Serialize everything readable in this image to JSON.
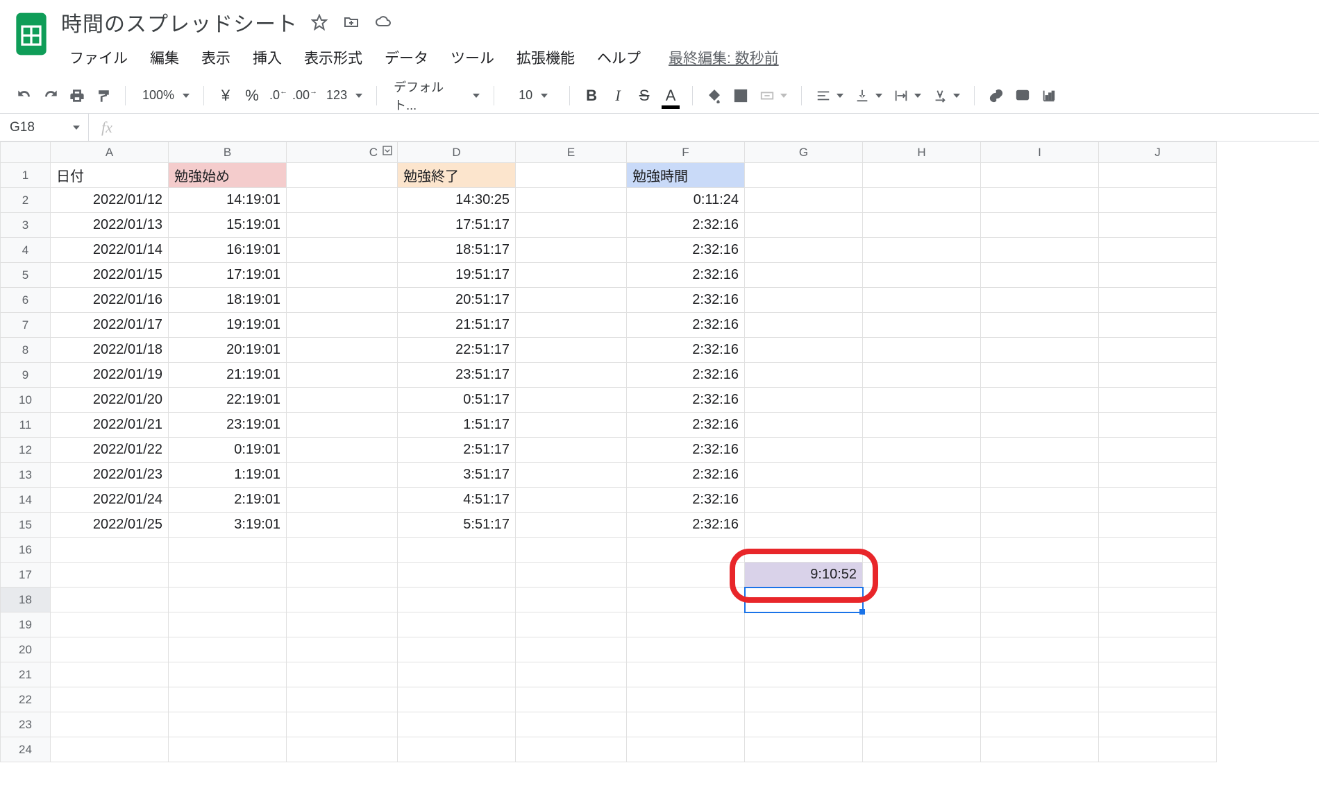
{
  "doc": {
    "title": "時間のスプレッドシート"
  },
  "menubar": {
    "items": [
      "ファイル",
      "編集",
      "表示",
      "挿入",
      "表示形式",
      "データ",
      "ツール",
      "拡張機能",
      "ヘルプ"
    ],
    "last_edit": "最終編集: 数秒前"
  },
  "toolbar": {
    "zoom": "100%",
    "currency": "¥",
    "percent": "%",
    "dec_dec": ".0",
    "inc_dec": ".00",
    "numfmt": "123",
    "font": "デフォルト...",
    "fontsize": "10"
  },
  "namebox": {
    "value": "G18"
  },
  "columns": [
    "A",
    "B",
    "C",
    "D",
    "E",
    "F",
    "G",
    "H",
    "I",
    "J"
  ],
  "rows": [
    1,
    2,
    3,
    4,
    5,
    6,
    7,
    8,
    9,
    10,
    11,
    12,
    13,
    14,
    15,
    16,
    17,
    18,
    19,
    20,
    21,
    22,
    23,
    24
  ],
  "headers": {
    "A": "日付",
    "B": "勉強始め",
    "D": "勉強終了",
    "F": "勉強時間"
  },
  "table": [
    {
      "A": "2022/01/12",
      "B": "14:19:01",
      "D": "14:30:25",
      "F": "0:11:24"
    },
    {
      "A": "2022/01/13",
      "B": "15:19:01",
      "D": "17:51:17",
      "F": "2:32:16"
    },
    {
      "A": "2022/01/14",
      "B": "16:19:01",
      "D": "18:51:17",
      "F": "2:32:16"
    },
    {
      "A": "2022/01/15",
      "B": "17:19:01",
      "D": "19:51:17",
      "F": "2:32:16"
    },
    {
      "A": "2022/01/16",
      "B": "18:19:01",
      "D": "20:51:17",
      "F": "2:32:16"
    },
    {
      "A": "2022/01/17",
      "B": "19:19:01",
      "D": "21:51:17",
      "F": "2:32:16"
    },
    {
      "A": "2022/01/18",
      "B": "20:19:01",
      "D": "22:51:17",
      "F": "2:32:16"
    },
    {
      "A": "2022/01/19",
      "B": "21:19:01",
      "D": "23:51:17",
      "F": "2:32:16"
    },
    {
      "A": "2022/01/20",
      "B": "22:19:01",
      "D": "0:51:17",
      "F": "2:32:16"
    },
    {
      "A": "2022/01/21",
      "B": "23:19:01",
      "D": "1:51:17",
      "F": "2:32:16"
    },
    {
      "A": "2022/01/22",
      "B": "0:19:01",
      "D": "2:51:17",
      "F": "2:32:16"
    },
    {
      "A": "2022/01/23",
      "B": "1:19:01",
      "D": "3:51:17",
      "F": "2:32:16"
    },
    {
      "A": "2022/01/24",
      "B": "2:19:01",
      "D": "4:51:17",
      "F": "2:32:16"
    },
    {
      "A": "2022/01/25",
      "B": "3:19:01",
      "D": "5:51:17",
      "F": "2:32:16"
    }
  ],
  "g17": "9:10:52",
  "selection": {
    "cell": "G18",
    "row": 18,
    "col": "G"
  }
}
